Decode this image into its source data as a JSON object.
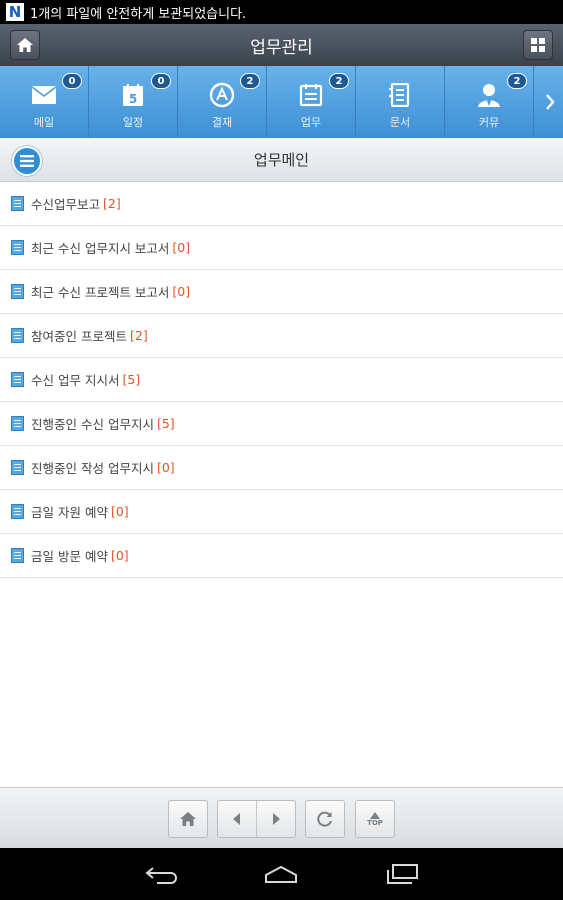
{
  "status_bar": {
    "logo": "N",
    "notification": "1개의 파일에 안전하게 보관되었습니다."
  },
  "header": {
    "title": "업무관리",
    "home_icon": "home-icon",
    "grid_icon": "grid-icon"
  },
  "tabs": [
    {
      "label": "메일",
      "badge": "0",
      "icon": "mail-icon"
    },
    {
      "label": "일정",
      "badge": "0",
      "icon": "calendar-icon"
    },
    {
      "label": "결재",
      "badge": "2",
      "icon": "approval-icon"
    },
    {
      "label": "업무",
      "badge": "2",
      "icon": "task-icon"
    },
    {
      "label": "문서",
      "badge": "",
      "icon": "document-icon"
    },
    {
      "label": "커뮤",
      "badge": "2",
      "icon": "community-icon"
    }
  ],
  "subheader": {
    "title": "업무메인",
    "menu_icon": "menu-icon"
  },
  "list": [
    {
      "label": "수신업무보고",
      "count": "[2]"
    },
    {
      "label": "최근 수신 업무지시 보고서",
      "count": "[0]"
    },
    {
      "label": "최근 수신 프로젝트 보고서",
      "count": "[0]"
    },
    {
      "label": "참여중인 프로젝트",
      "count": "[2]"
    },
    {
      "label": "수신 업무 지시서",
      "count": "[5]"
    },
    {
      "label": "진행중인 수신 업무지시",
      "count": "[5]"
    },
    {
      "label": "진행중인 작성 업무지시",
      "count": "[0]"
    },
    {
      "label": "금일 자원 예약",
      "count": "[0]"
    },
    {
      "label": "금일 방문 예약",
      "count": "[0]"
    }
  ],
  "toolbar": {
    "top_label": "TOP"
  },
  "colors": {
    "tab_bar": "#4a9ddf",
    "badge": "#1d5a95",
    "count": "#e0552a",
    "header": "#444c56"
  }
}
